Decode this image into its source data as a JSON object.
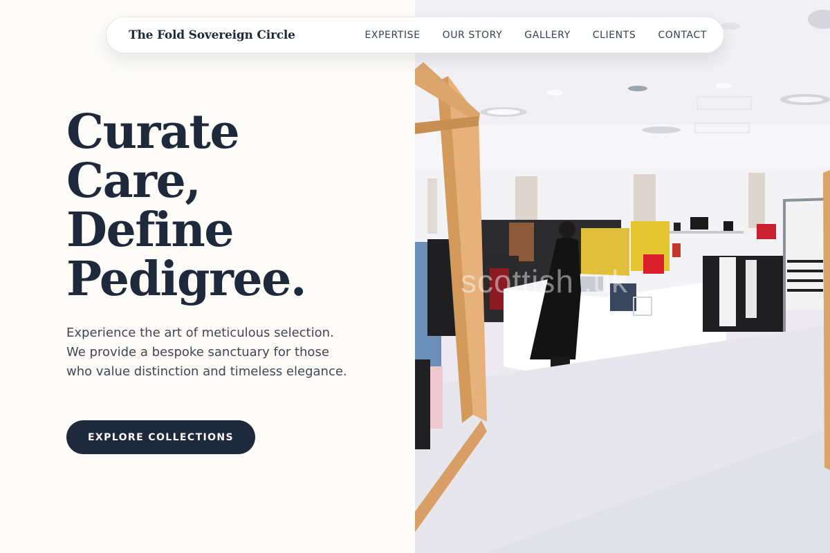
{
  "nav": {
    "brand": "The Fold Sovereign Circle",
    "links": [
      "EXPERTISE",
      "OUR STORY",
      "GALLERY",
      "CLIENTS",
      "CONTACT"
    ]
  },
  "hero": {
    "title_lines": [
      "Curate",
      "Care,",
      "Define",
      "Pedigree."
    ],
    "subtitle": "Experience the art of meticulous selection. We provide a bespoke sanctuary for those who value distinction and timeless elegance.",
    "cta_label": "EXPLORE COLLECTIONS"
  },
  "photo": {
    "watermark": "scottish    .uk"
  },
  "colors": {
    "background": "#fdfcf9",
    "navy": "#1e293b",
    "body_text": "#3f4656"
  }
}
